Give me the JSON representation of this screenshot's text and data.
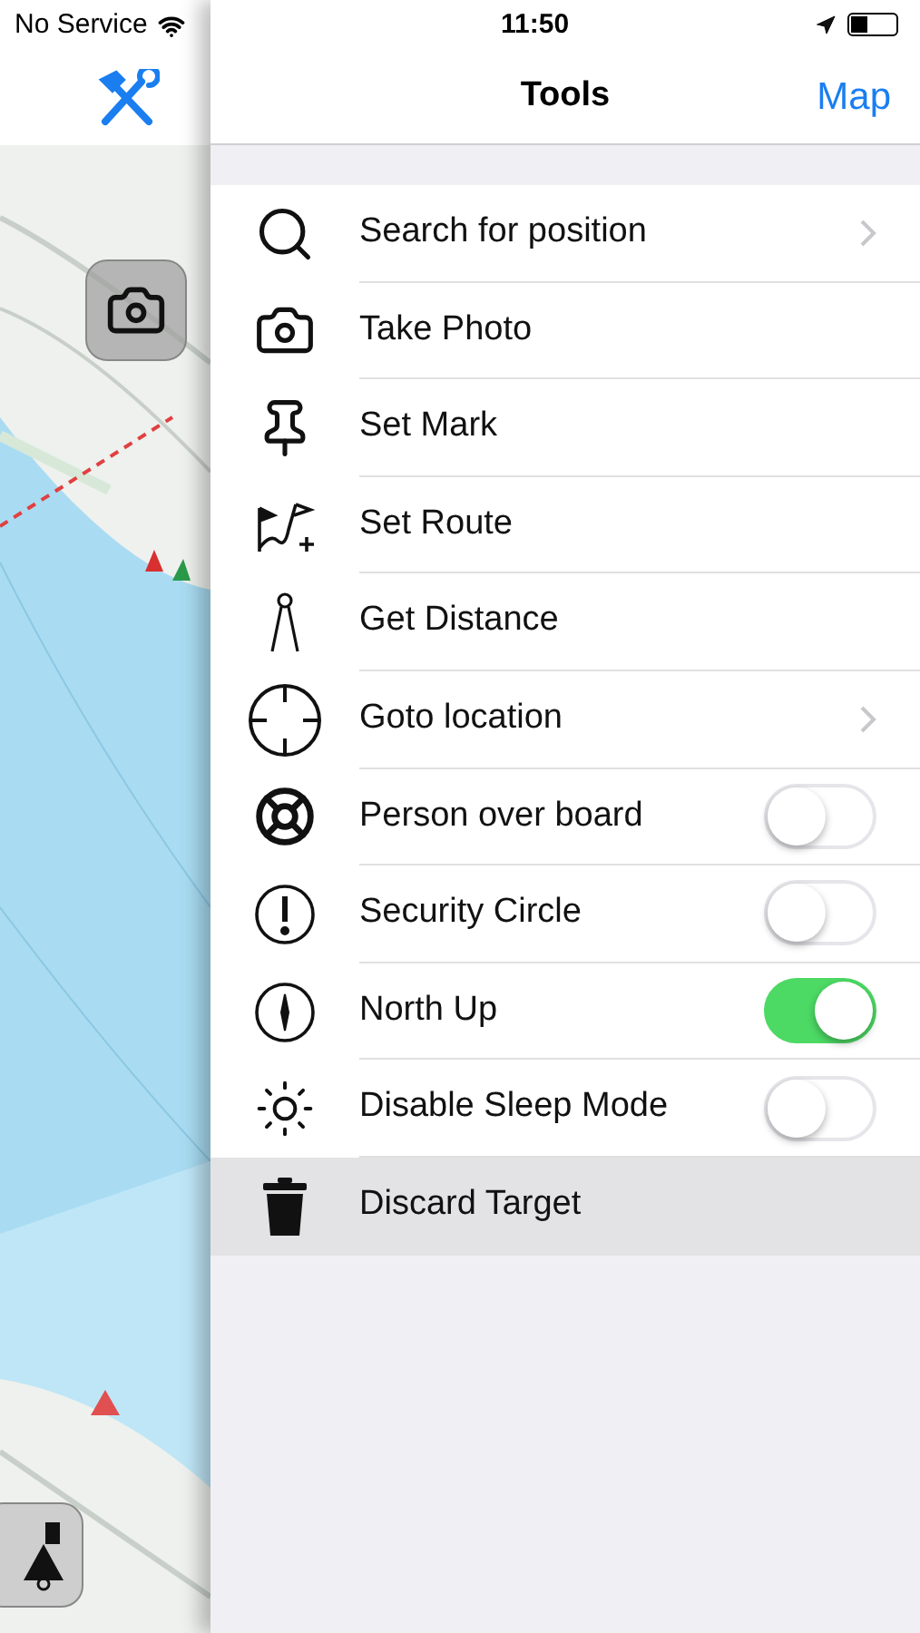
{
  "status_bar": {
    "carrier": "No Service",
    "time": "11:50"
  },
  "nav": {
    "title": "Tools",
    "right_button": "Map"
  },
  "rows": [
    {
      "kind": "link",
      "label": "Search for position",
      "selected": false
    },
    {
      "kind": "action",
      "label": "Take Photo",
      "selected": false
    },
    {
      "kind": "action",
      "label": "Set Mark",
      "selected": false
    },
    {
      "kind": "action",
      "label": "Set Route",
      "selected": false
    },
    {
      "kind": "action",
      "label": "Get Distance",
      "selected": false
    },
    {
      "kind": "link",
      "label": "Goto location",
      "selected": false
    },
    {
      "kind": "toggle",
      "label": "Person over board",
      "on": false,
      "selected": false
    },
    {
      "kind": "toggle",
      "label": "Security Circle",
      "on": false,
      "selected": false
    },
    {
      "kind": "toggle",
      "label": "North Up",
      "on": true,
      "selected": false
    },
    {
      "kind": "toggle",
      "label": "Disable Sleep Mode",
      "on": false,
      "selected": false
    },
    {
      "kind": "action",
      "label": "Discard Target",
      "selected": true
    }
  ]
}
